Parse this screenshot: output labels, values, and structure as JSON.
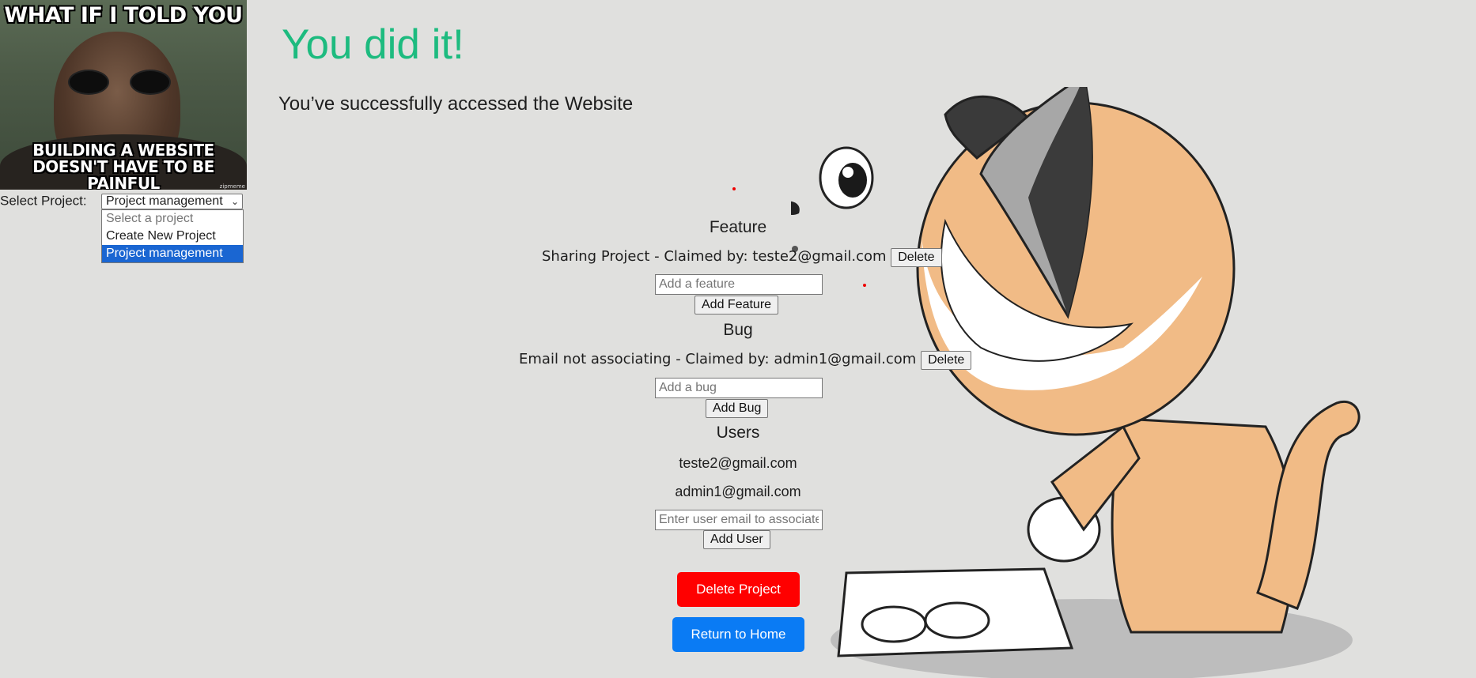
{
  "meme": {
    "top_text": "WHAT IF I TOLD YOU",
    "bottom_text": "BUILDING A WEBSITE DOESN'T HAVE TO BE PAINFUL",
    "watermark": "zipmeme"
  },
  "project_select": {
    "label": "Select Project:",
    "value": "Project management",
    "options": [
      "Select a project",
      "Create New Project",
      "Project management"
    ]
  },
  "header": {
    "title": "You did it!",
    "subtitle": "You’ve successfully accessed the Website"
  },
  "features": {
    "heading": "Feature",
    "items": [
      {
        "text": "Sharing Project - Claimed by: teste2@gmail.com",
        "delete_label": "Delete"
      }
    ],
    "input_placeholder": "Add a feature",
    "add_label": "Add Feature"
  },
  "bugs": {
    "heading": "Bug",
    "items": [
      {
        "text": "Email not associating - Claimed by: admin1@gmail.com",
        "delete_label": "Delete"
      }
    ],
    "input_placeholder": "Add a bug",
    "add_label": "Add Bug"
  },
  "users": {
    "heading": "Users",
    "items": [
      "teste2@gmail.com",
      "admin1@gmail.com"
    ],
    "input_placeholder": "Enter user email to associate",
    "add_label": "Add User"
  },
  "actions": {
    "delete_project_label": "Delete Project",
    "return_home_label": "Return to Home"
  },
  "colors": {
    "title": "#1dbb7f",
    "delete_project": "#ff0000",
    "return_home": "#0a7bf4",
    "background": "#e0e0de"
  }
}
